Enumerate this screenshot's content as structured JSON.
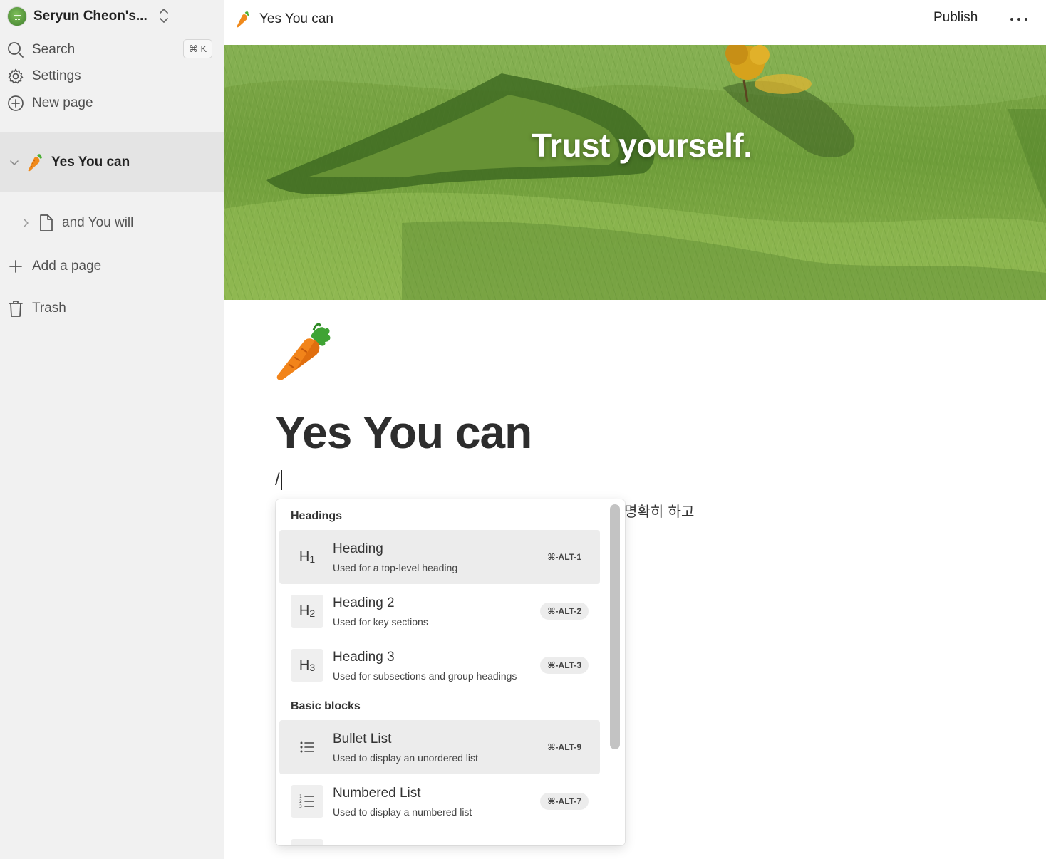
{
  "sidebar": {
    "workspace_name": "Seryun Cheon's...",
    "search_label": "Search",
    "search_shortcut": "⌘ K",
    "settings_label": "Settings",
    "new_page_label": "New page",
    "pages": [
      {
        "label": "Yes You can",
        "icon": "carrot-emoji",
        "expanded": true,
        "active": true
      },
      {
        "label": "and You will",
        "icon": "document-icon",
        "expanded": false,
        "active": false
      }
    ],
    "add_page_label": "Add a page",
    "trash_label": "Trash"
  },
  "topbar": {
    "title": "Yes You can",
    "publish_label": "Publish"
  },
  "cover": {
    "quote": "Trust yourself."
  },
  "page": {
    "title": "Yes You can",
    "input_text": "/",
    "partial_text": "명확히 하고"
  },
  "slash_menu": {
    "groups": [
      {
        "label": "Headings",
        "items": [
          {
            "icon": "H1",
            "title": "Heading",
            "description": "Used for a top-level heading",
            "shortcut": "⌘-ALT-1",
            "highlighted": true
          },
          {
            "icon": "H2",
            "title": "Heading 2",
            "description": "Used for key sections",
            "shortcut": "⌘-ALT-2",
            "highlighted": false
          },
          {
            "icon": "H3",
            "title": "Heading 3",
            "description": "Used for subsections and group headings",
            "shortcut": "⌘-ALT-3",
            "highlighted": false
          }
        ]
      },
      {
        "label": "Basic blocks",
        "items": [
          {
            "icon": "bullet-list-icon",
            "title": "Bullet List",
            "description": "Used to display an unordered list",
            "shortcut": "⌘-ALT-9",
            "highlighted": true
          },
          {
            "icon": "numbered-list-icon",
            "title": "Numbered List",
            "description": "Used to display a numbered list",
            "shortcut": "⌘-ALT-7",
            "highlighted": false
          }
        ]
      }
    ]
  },
  "colors": {
    "sidebar_bg": "#f1f1f1",
    "active_row_bg": "#e4e4e4",
    "menu_highlight": "#ececec",
    "text": "#2f2f2f"
  }
}
